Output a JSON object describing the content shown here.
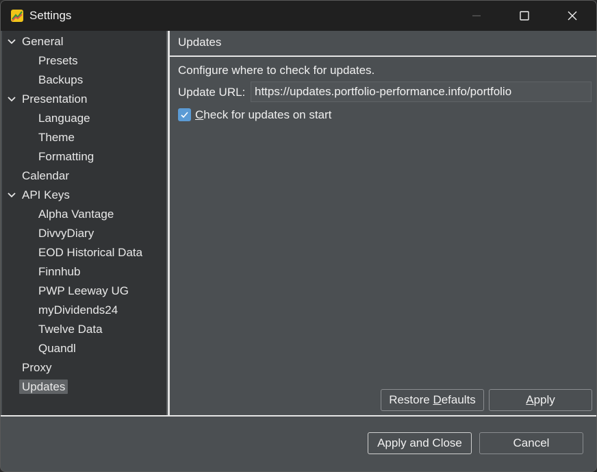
{
  "window": {
    "title": "Settings"
  },
  "sidebar": {
    "items": [
      {
        "label": "General",
        "expanded": true
      },
      {
        "label": "Presets"
      },
      {
        "label": "Backups"
      },
      {
        "label": "Presentation",
        "expanded": true
      },
      {
        "label": "Language"
      },
      {
        "label": "Theme"
      },
      {
        "label": "Formatting"
      },
      {
        "label": "Calendar"
      },
      {
        "label": "API Keys",
        "expanded": true
      },
      {
        "label": "Alpha Vantage"
      },
      {
        "label": "DivvyDiary"
      },
      {
        "label": "EOD Historical Data"
      },
      {
        "label": "Finnhub"
      },
      {
        "label": "PWP Leeway UG"
      },
      {
        "label": "myDividends24"
      },
      {
        "label": "Twelve Data"
      },
      {
        "label": "Quandl"
      },
      {
        "label": "Proxy"
      },
      {
        "label": "Updates",
        "selected": true
      }
    ]
  },
  "content": {
    "title": "Updates",
    "description": "Configure where to check for updates.",
    "url_label": "Update URL:",
    "url_value": "https://updates.portfolio-performance.info/portfolio",
    "check_first": "C",
    "check_rest": "heck for updates on start",
    "check_checked": true,
    "restore_pre": "Restore ",
    "restore_mnemonic": "D",
    "restore_post": "efaults",
    "apply_mnemonic": "A",
    "apply_post": "pply"
  },
  "footer": {
    "apply_close_label": "Apply and Close",
    "cancel_label": "Cancel"
  },
  "colors": {
    "accent": "#5b9bd5",
    "selected_bg": "#606366",
    "panel_bg": "#4b4f52",
    "sidebar_bg": "#323436",
    "titlebar_bg": "#202020"
  }
}
